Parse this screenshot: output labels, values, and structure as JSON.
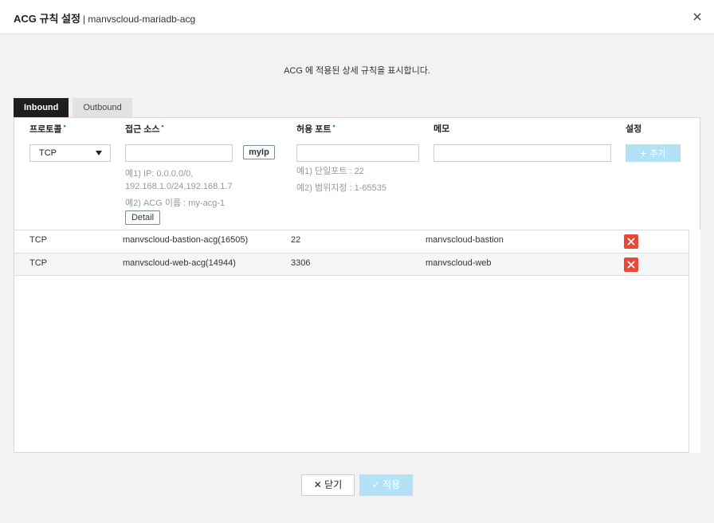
{
  "dialog": {
    "title": "ACG 규칙 설정",
    "subtitle": "| manvscloud-mariadb-acg",
    "description": "ACG 에 적용된 상세 규칙을 표시합니다."
  },
  "tabs": [
    {
      "label": "Inbound",
      "active": true
    },
    {
      "label": "Outbound",
      "active": false
    }
  ],
  "columns": {
    "protocol": "프로토콜",
    "source": "접근 소스",
    "port": "허용 포트",
    "memo": "메모",
    "settings": "설정",
    "required_marker": "•"
  },
  "form": {
    "protocol_value": "TCP",
    "source_value": "",
    "port_value": "",
    "memo_value": "",
    "myip_label": "myIp",
    "source_hint_1": "예1) IP: 0.0.0.0/0,",
    "source_hint_2": "192.168.1.0/24,192.168.1.7",
    "source_hint_3": "예2) ACG 이름 : my-acg-1",
    "detail_label": "Detail",
    "port_hint_1": "예1) 단일포트 : 22",
    "port_hint_2": "예2) 범위지정 : 1-65535",
    "add_label": "추가"
  },
  "rules": [
    {
      "protocol": "TCP",
      "source": "manvscloud-bastion-acg(16505)",
      "port": "22",
      "memo": "manvscloud-bastion"
    },
    {
      "protocol": "TCP",
      "source": "manvscloud-web-acg(14944)",
      "port": "3306",
      "memo": "manvscloud-web"
    }
  ],
  "footer": {
    "close_label": "닫기",
    "apply_label": "적용"
  },
  "colors": {
    "accent_disabled": "#b3e2f6",
    "delete": "#e5493a",
    "active_tab": "#1e1e1e",
    "required_dot": "#1a7fd6"
  },
  "icons": [
    "close-icon",
    "dropdown-arrow-icon",
    "plus-icon",
    "delete-icon",
    "check-icon"
  ]
}
